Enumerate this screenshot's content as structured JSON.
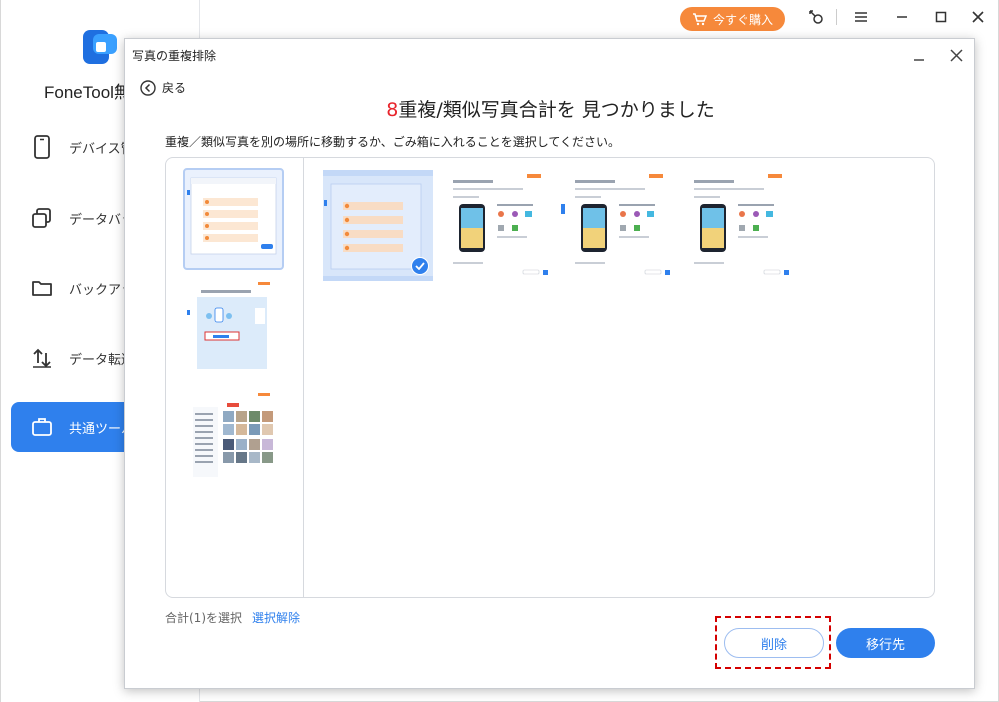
{
  "app": {
    "brand": "FoneTool無",
    "buy_label": "今すぐ購入",
    "nav": [
      {
        "label": "デバイス管",
        "icon": "phone-icon"
      },
      {
        "label": "データバッ",
        "icon": "copy-icon"
      },
      {
        "label": "バックアッ",
        "icon": "folder-icon"
      },
      {
        "label": "データ転送",
        "icon": "transfer-icon"
      },
      {
        "label": "共通ツール",
        "icon": "toolbox-icon"
      }
    ]
  },
  "dialog": {
    "title": "写真の重複排除",
    "back_label": "戻る",
    "headline_count": "8",
    "headline_text": "重複/類似写真合計を 見つかりました",
    "instruction": "重複／類似写真を別の場所に移動するか、ごみ箱に入れることを選択してください。",
    "footer_count": "合計(1)を選択",
    "deselect_label": "選択解除",
    "delete_label": "削除",
    "move_label": "移行先"
  },
  "colors": {
    "accent": "#2f80ed",
    "buy": "#f6893b",
    "highlight": "#d40000",
    "count": "#e8242c"
  }
}
